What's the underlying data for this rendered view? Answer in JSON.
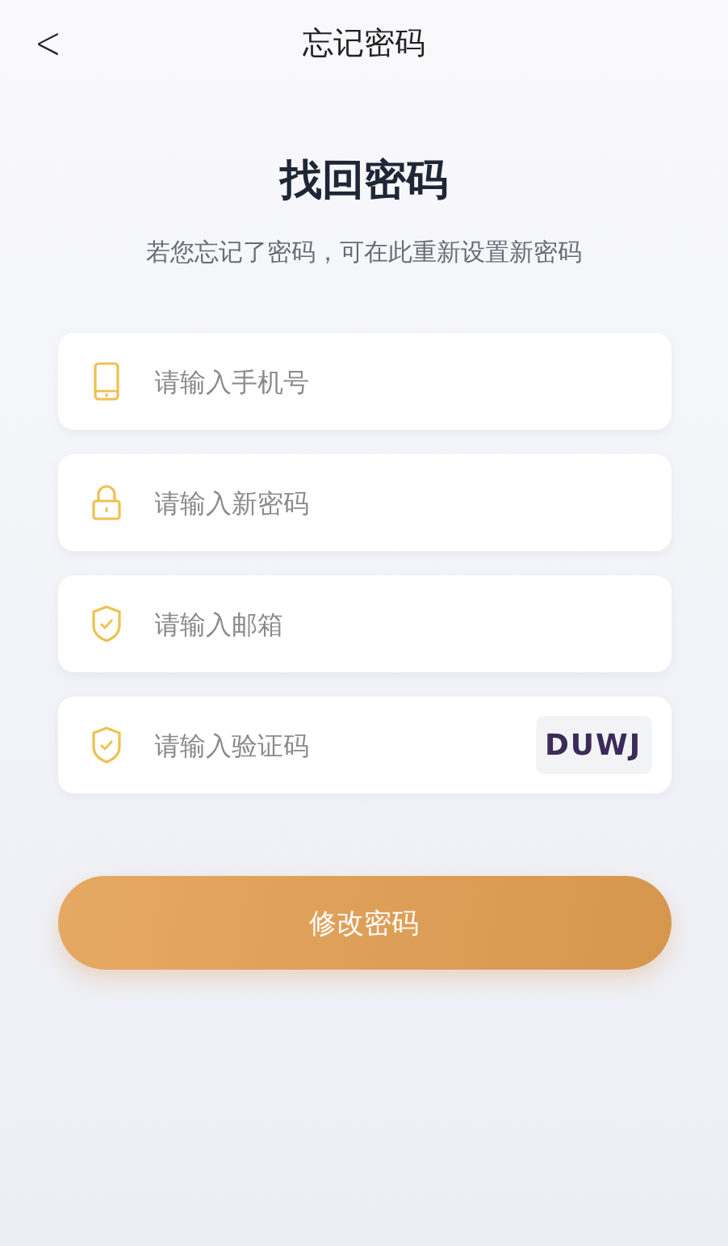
{
  "header": {
    "back": "<",
    "title": "忘记密码"
  },
  "heading": "找回密码",
  "subtitle": "若您忘记了密码，可在此重新设置新密码",
  "fields": [
    {
      "kind": "phone",
      "placeholder": "请输入手机号"
    },
    {
      "kind": "lock",
      "placeholder": "请输入新密码"
    },
    {
      "kind": "shield",
      "placeholder": "请输入邮箱"
    },
    {
      "kind": "shield",
      "placeholder": "请输入验证码",
      "captcha": "DUWJ"
    }
  ],
  "submit": "修改密码"
}
